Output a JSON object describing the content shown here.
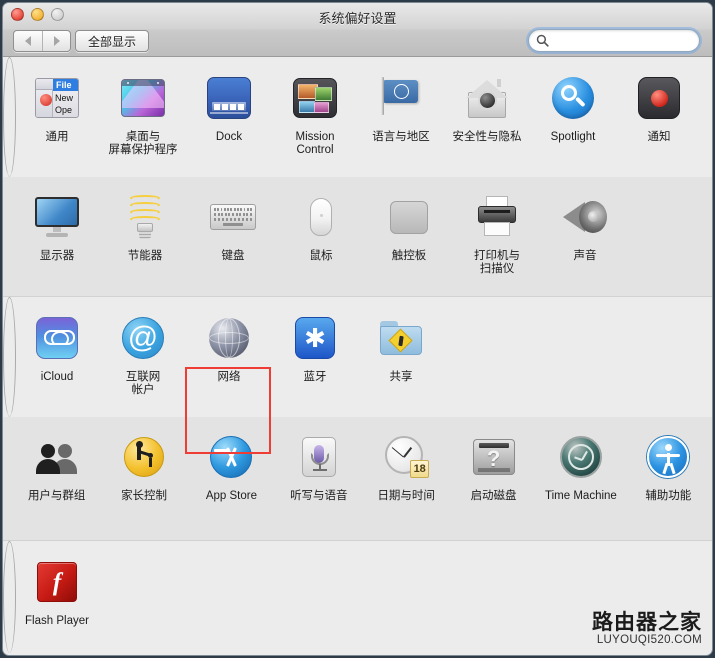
{
  "window": {
    "title": "系统偏好设置",
    "traffic_lights": [
      "close-button",
      "minimize-button",
      "zoom-button"
    ]
  },
  "toolbar": {
    "back_label": "◀",
    "forward_label": "▶",
    "show_all_label": "全部显示",
    "search": {
      "value": "",
      "placeholder": "",
      "icon": "search-icon"
    }
  },
  "annotation": {
    "type": "red-rectangle-highlight",
    "target": "网络",
    "color": "#ef3c35"
  },
  "watermark": {
    "chinese": "路由器之家",
    "english": "LUYOUQI520.COM"
  },
  "rows": [
    {
      "id": "row-personal",
      "items": [
        {
          "label": "通用",
          "icon": "general-icon"
        },
        {
          "label": "桌面与\n屏幕保护程序",
          "line1": "桌面与",
          "line2": "屏幕保护程序",
          "icon": "desktop-screensaver-icon"
        },
        {
          "label": "Dock",
          "icon": "dock-icon"
        },
        {
          "label": "Mission\nControl",
          "line1": "Mission",
          "line2": "Control",
          "icon": "mission-control-icon"
        },
        {
          "label": "语言与地区",
          "icon": "language-region-icon"
        },
        {
          "label": "安全性与隐私",
          "icon": "security-privacy-icon"
        },
        {
          "label": "Spotlight",
          "icon": "spotlight-icon"
        },
        {
          "label": "通知",
          "icon": "notifications-icon"
        }
      ]
    },
    {
      "id": "row-hardware",
      "items": [
        {
          "label": "显示器",
          "icon": "displays-icon"
        },
        {
          "label": "节能器",
          "icon": "energy-saver-icon"
        },
        {
          "label": "键盘",
          "icon": "keyboard-icon"
        },
        {
          "label": "鼠标",
          "icon": "mouse-icon"
        },
        {
          "label": "触控板",
          "icon": "trackpad-icon"
        },
        {
          "label": "打印机与\n扫描仪",
          "line1": "打印机与",
          "line2": "扫描仪",
          "icon": "printers-scanners-icon"
        },
        {
          "label": "声音",
          "icon": "sound-icon"
        }
      ]
    },
    {
      "id": "row-internet",
      "items": [
        {
          "label": "iCloud",
          "icon": "icloud-icon"
        },
        {
          "label": "互联网\n帐户",
          "line1": "互联网",
          "line2": "帐户",
          "icon": "internet-accounts-icon"
        },
        {
          "label": "网络",
          "icon": "network-icon",
          "highlighted": true
        },
        {
          "label": "蓝牙",
          "icon": "bluetooth-icon"
        },
        {
          "label": "共享",
          "icon": "sharing-icon"
        }
      ]
    },
    {
      "id": "row-system",
      "items": [
        {
          "label": "用户与群组",
          "icon": "users-groups-icon"
        },
        {
          "label": "家长控制",
          "icon": "parental-controls-icon"
        },
        {
          "label": "App Store",
          "icon": "app-store-icon"
        },
        {
          "label": "听写与语音",
          "icon": "dictation-speech-icon"
        },
        {
          "label": "日期与时间",
          "icon": "date-time-icon",
          "badge": "18"
        },
        {
          "label": "启动磁盘",
          "icon": "startup-disk-icon"
        },
        {
          "label": "Time Machine",
          "icon": "time-machine-icon"
        },
        {
          "label": "辅助功能",
          "icon": "accessibility-icon"
        }
      ]
    },
    {
      "id": "row-other",
      "items": [
        {
          "label": "Flash Player",
          "icon": "flash-player-icon"
        }
      ]
    }
  ]
}
